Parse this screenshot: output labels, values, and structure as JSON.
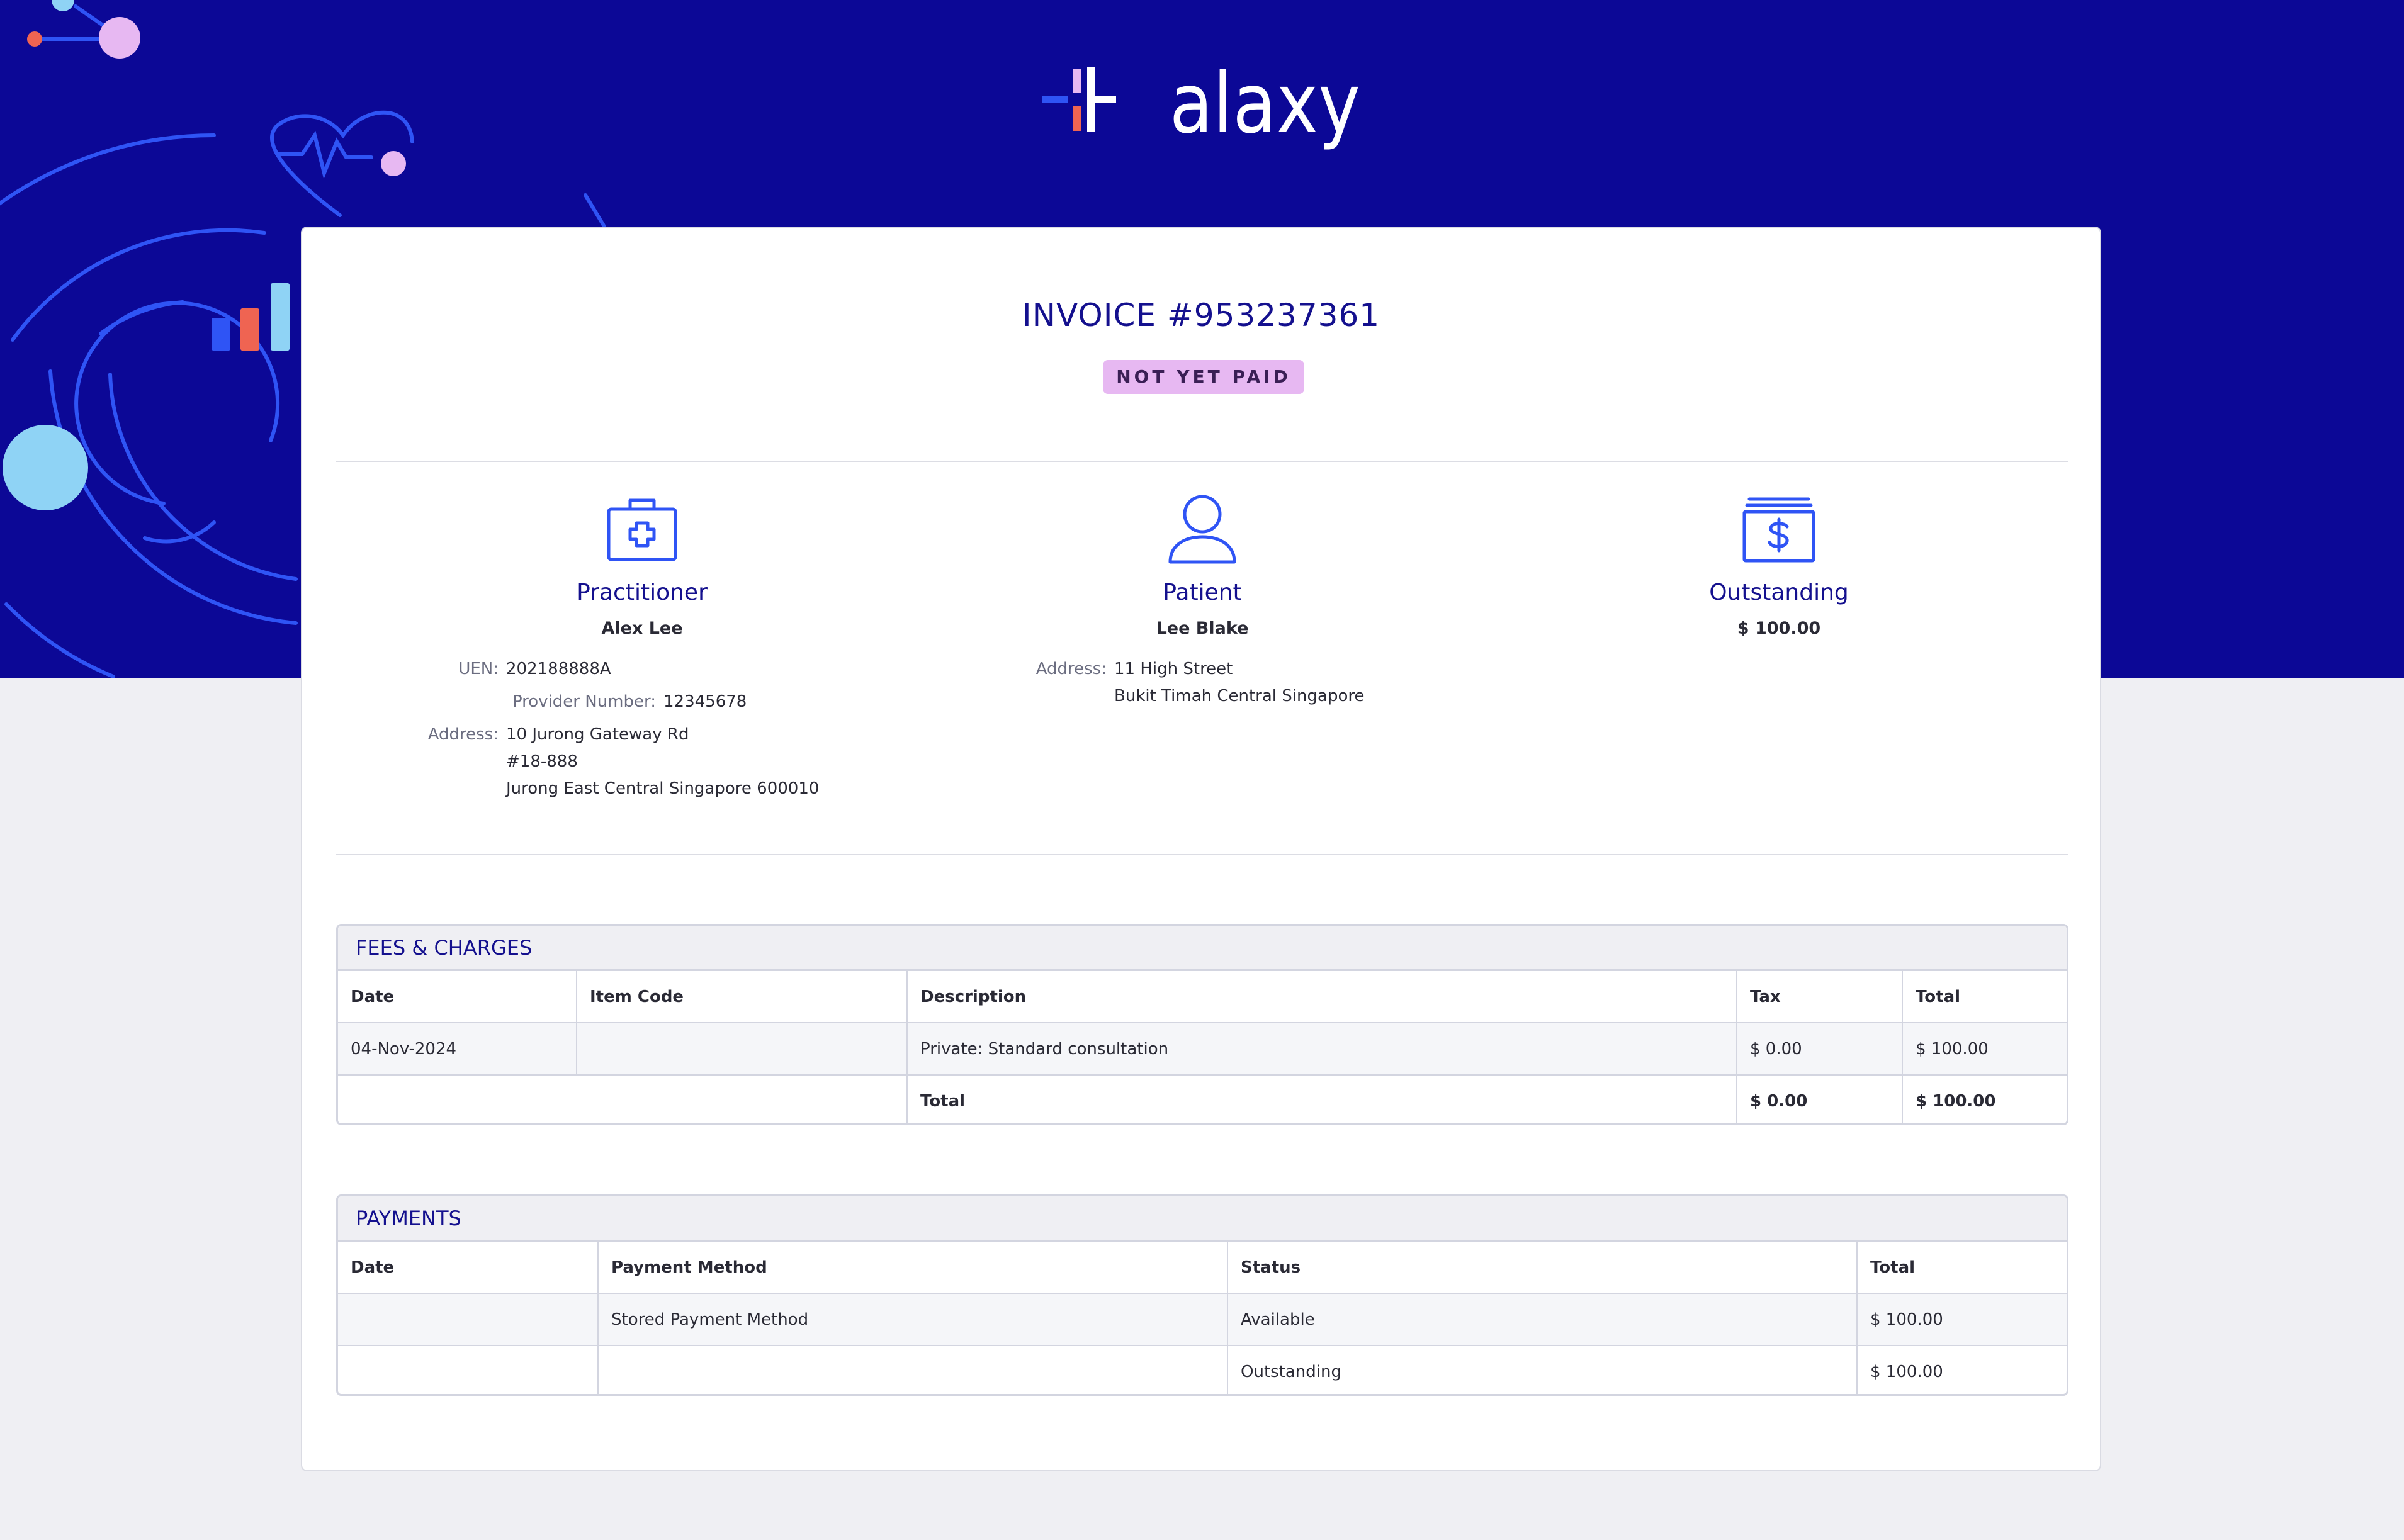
{
  "brand": {
    "logo_text": "Halaxy",
    "colors": {
      "header_bg": "#0c0896",
      "accent_blue": "#2f54f5",
      "badge_pink": "#e7b8f2",
      "title_navy": "#14108e"
    }
  },
  "invoice": {
    "title": "INVOICE #953237361",
    "status_badge": "NOT YET PAID"
  },
  "practitioner": {
    "icon": "medical-kit-icon",
    "heading": "Practitioner",
    "name": "Alex Lee",
    "uen_label": "UEN:",
    "uen": "202188888A",
    "provider_label": "Provider Number:",
    "provider_number": "12345678",
    "address_label": "Address:",
    "address_lines": [
      "10 Jurong Gateway Rd",
      "#18-888",
      "Jurong East Central Singapore 600010"
    ]
  },
  "patient": {
    "icon": "person-icon",
    "heading": "Patient",
    "name": "Lee Blake",
    "address_label": "Address:",
    "address_lines": [
      "11 High Street",
      "Bukit Timah Central Singapore"
    ]
  },
  "outstanding": {
    "icon": "cash-icon",
    "heading": "Outstanding",
    "amount": "$ 100.00"
  },
  "fees": {
    "heading": "FEES & CHARGES",
    "columns": [
      "Date",
      "Item Code",
      "Description",
      "Tax",
      "Total"
    ],
    "rows": [
      {
        "date": "04-Nov-2024",
        "item_code": "",
        "description": "Private: Standard consultation",
        "tax": "$ 0.00",
        "total": "$ 100.00"
      }
    ],
    "total_row": {
      "label": "Total",
      "tax": "$ 0.00",
      "total": "$ 100.00"
    }
  },
  "payments": {
    "heading": "PAYMENTS",
    "columns": [
      "Date",
      "Payment Method",
      "Status",
      "Total"
    ],
    "rows": [
      {
        "date": "",
        "method": "Stored Payment Method",
        "status": "Available",
        "total": "$ 100.00"
      },
      {
        "date": "",
        "method": "",
        "status": "Outstanding",
        "total": "$ 100.00"
      }
    ]
  }
}
